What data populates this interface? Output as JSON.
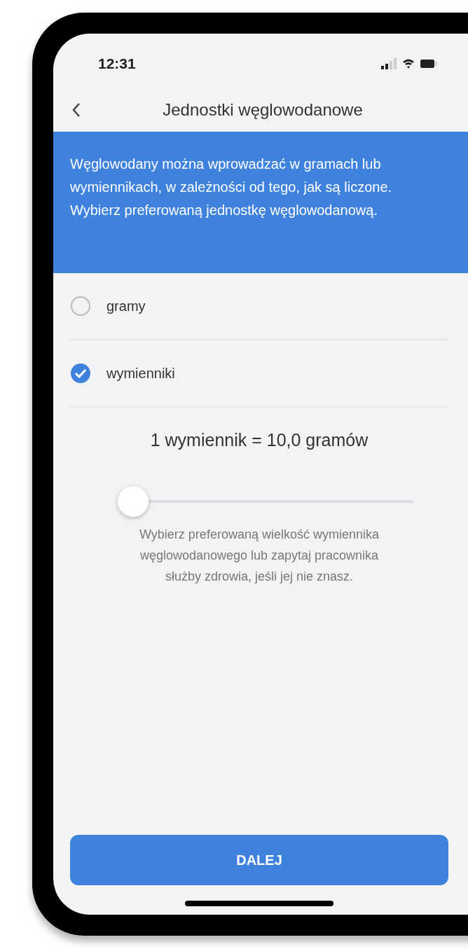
{
  "status_bar": {
    "time": "12:31"
  },
  "header": {
    "title": "Jednostki węglowodanowe"
  },
  "banner": {
    "text": "Węglowodany można wprowadzać w gramach lub wymiennikach, w zależności od tego, jak są liczone. Wybierz preferowaną jednostkę węglowodanową."
  },
  "options": [
    {
      "label": "gramy",
      "selected": false
    },
    {
      "label": "wymienniki",
      "selected": true
    }
  ],
  "exchange": {
    "value": "1 wymiennik = 10,0 gramów",
    "slider": {
      "level": 0
    },
    "hint": "Wybierz preferowaną wielkość wymiennika węglowodanowego lub zapytaj pracownika służby zdrowia, jeśli jej nie znasz."
  },
  "button": {
    "label": "DALEJ"
  }
}
